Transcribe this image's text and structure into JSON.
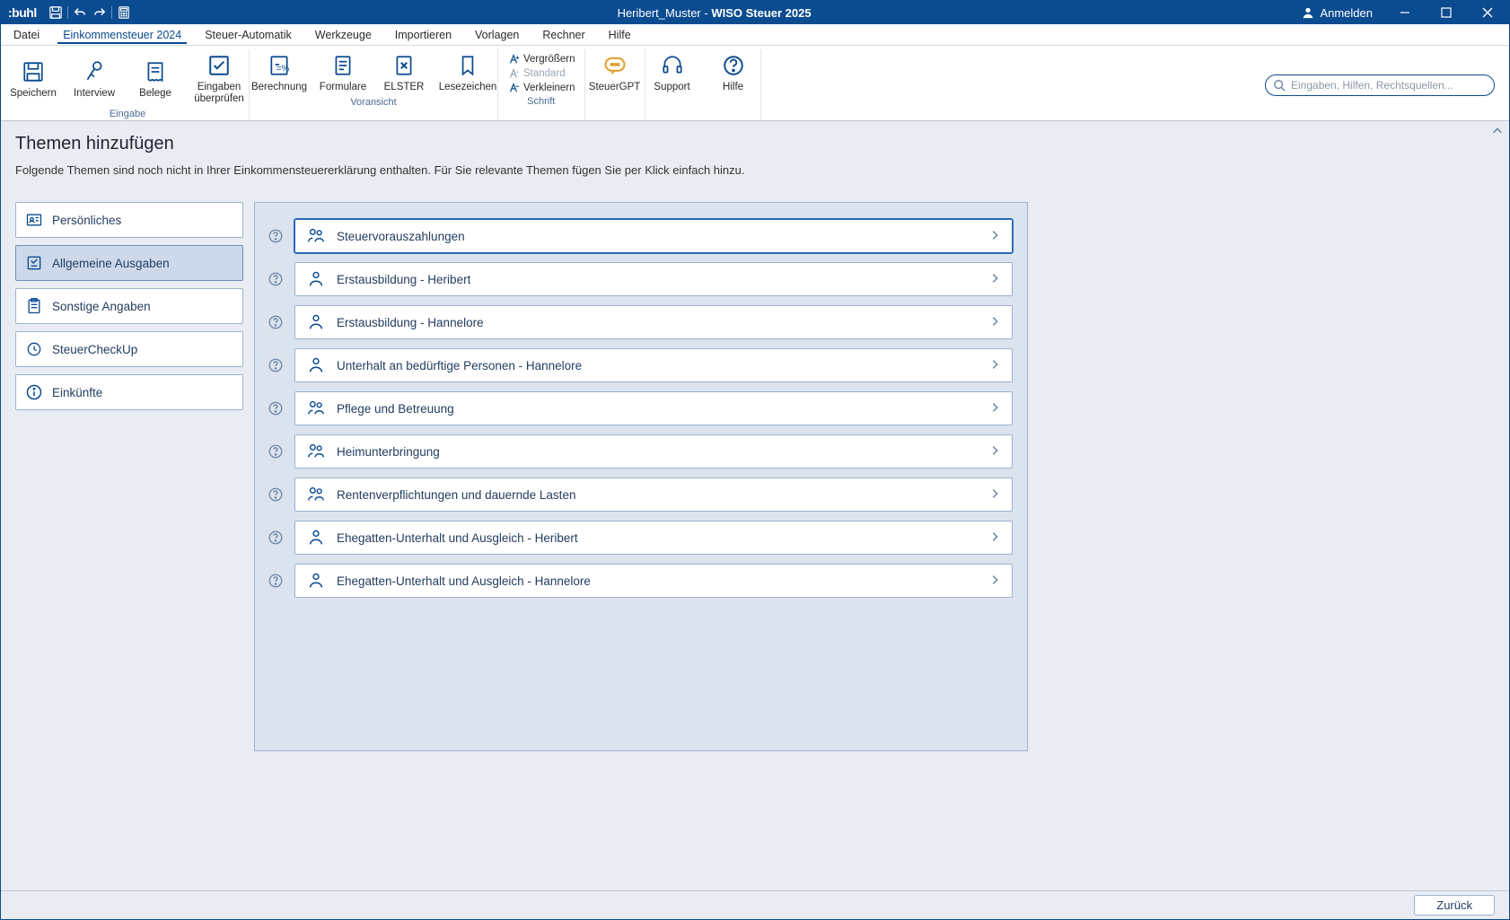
{
  "titlebar": {
    "logo": ":buhl",
    "title_doc": "Heribert_Muster",
    "title_app": "WISO Steuer 2025",
    "login": "Anmelden"
  },
  "menu": {
    "items": [
      {
        "label": "Datei"
      },
      {
        "label": "Einkommensteuer 2024",
        "active": true
      },
      {
        "label": "Steuer-Automatik"
      },
      {
        "label": "Werkzeuge"
      },
      {
        "label": "Importieren"
      },
      {
        "label": "Vorlagen"
      },
      {
        "label": "Rechner"
      },
      {
        "label": "Hilfe"
      }
    ]
  },
  "ribbon": {
    "groups": {
      "eingabe": {
        "name": "Eingabe",
        "buttons": {
          "speichern": "Speichern",
          "interview": "Interview",
          "belege": "Belege",
          "eingaben": "Eingaben überprüfen"
        }
      },
      "voransicht": {
        "name": "Voransicht",
        "buttons": {
          "berechnung": "Berechnung",
          "formulare": "Formulare",
          "elster": "ELSTER",
          "lesezeichen": "Lesezeichen"
        }
      },
      "schrift": {
        "name": "Schrift",
        "larger": "Vergrößern",
        "standard": "Standard",
        "smaller": "Verkleinern"
      },
      "other": {
        "steuergpt": "SteuerGPT",
        "support": "Support",
        "hilfe": "Hilfe"
      }
    },
    "search_placeholder": "Eingaben, Hilfen, Rechtsquellen..."
  },
  "page": {
    "heading": "Themen hinzufügen",
    "subtitle": "Folgende Themen sind noch nicht in Ihrer Einkommensteuererklärung enthalten. Für Sie relevante Themen fügen Sie per Klick einfach hinzu."
  },
  "sidebar": {
    "items": [
      {
        "label": "Persönliches",
        "icon": "person-card"
      },
      {
        "label": "Allgemeine Ausgaben",
        "icon": "expenses",
        "selected": true
      },
      {
        "label": "Sonstige Angaben",
        "icon": "clipboard"
      },
      {
        "label": "SteuerCheckUp",
        "icon": "checkup"
      },
      {
        "label": "Einkünfte",
        "icon": "info"
      }
    ]
  },
  "topics": [
    {
      "label": "Steuervorauszahlungen",
      "icon": "couple",
      "selected": true
    },
    {
      "label": "Erstausbildung - Heribert",
      "icon": "single"
    },
    {
      "label": "Erstausbildung - Hannelore",
      "icon": "single"
    },
    {
      "label": "Unterhalt an bedürftige Personen - Hannelore",
      "icon": "single"
    },
    {
      "label": "Pflege und Betreuung",
      "icon": "couple"
    },
    {
      "label": "Heimunterbringung",
      "icon": "couple"
    },
    {
      "label": "Rentenverpflichtungen und dauernde Lasten",
      "icon": "couple"
    },
    {
      "label": "Ehegatten-Unterhalt und Ausgleich - Heribert",
      "icon": "single"
    },
    {
      "label": "Ehegatten-Unterhalt und Ausgleich - Hannelore",
      "icon": "single"
    }
  ],
  "footer": {
    "back": "Zurück"
  }
}
